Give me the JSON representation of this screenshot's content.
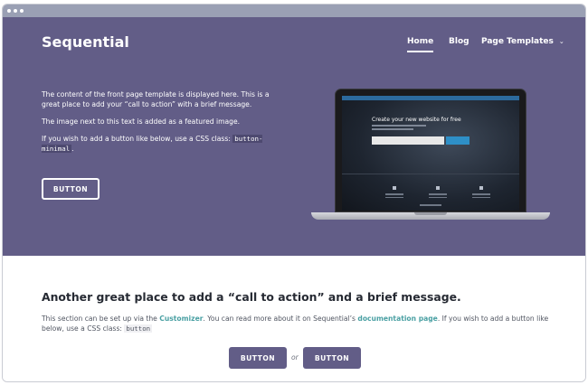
{
  "site": {
    "title": "Sequential"
  },
  "nav": {
    "items": [
      {
        "label": "Home",
        "active": true
      },
      {
        "label": "Blog",
        "active": false
      },
      {
        "label": "Page Templates",
        "active": false,
        "has_dropdown": true
      }
    ],
    "dropdown_icon": "chevron-down-icon"
  },
  "hero": {
    "paragraph_1": "The content of the front page template is displayed here. This is a great place to add your “call to action” with a brief message.",
    "paragraph_2": "The image next to this text is added as a featured image.",
    "paragraph_3_prefix": "If you wish to add a button like below, use a CSS class: ",
    "paragraph_3_code": "button-minimal",
    "paragraph_3_suffix": ".",
    "button_label": "BUTTON",
    "featured_image": {
      "screen_title": "Create your new website for free"
    }
  },
  "cta": {
    "heading": "Another great place to add a “call to action” and a brief message.",
    "text_1": "This section can be set up via the ",
    "link_customizer": "Customizer",
    "text_2": ". You can read more about it on Sequential’s ",
    "link_docs": "documentation page",
    "text_3": ". If you wish to add a button like below, use a CSS class: ",
    "code": "button",
    "button_1_label": "BUTTON",
    "or_label": "or",
    "button_2_label": "BUTTON"
  },
  "colors": {
    "hero_background": "#625d87",
    "accent_link": "#4aa0a3",
    "button_background": "#625d87",
    "heading_text": "#262a33"
  }
}
